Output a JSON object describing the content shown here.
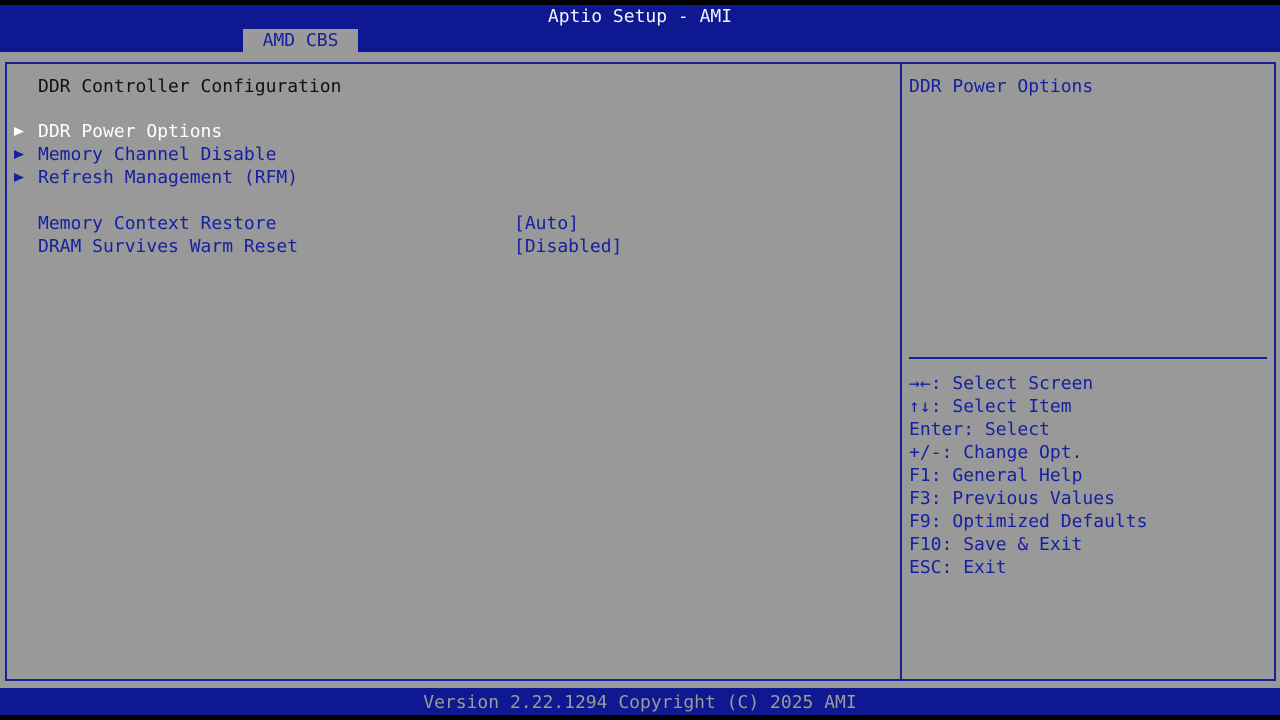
{
  "header": {
    "title": "Aptio Setup - AMI",
    "active_tab": "AMD CBS"
  },
  "page": {
    "heading": "DDR Controller Configuration",
    "submenus": [
      {
        "label": "DDR Power Options",
        "selected": true
      },
      {
        "label": "Memory Channel Disable",
        "selected": false
      },
      {
        "label": "Refresh Management (RFM)",
        "selected": false
      }
    ],
    "settings": [
      {
        "label": "Memory Context Restore",
        "value": "[Auto]"
      },
      {
        "label": "DRAM Survives Warm Reset",
        "value": "[Disabled]"
      }
    ]
  },
  "help_panel": {
    "description": "DDR Power Options",
    "keys": [
      {
        "key": "→←",
        "action": ": Select Screen"
      },
      {
        "key": "↑↓",
        "action": ": Select Item"
      },
      {
        "key": "Enter",
        "action": ": Select"
      },
      {
        "key": "+/-",
        "action": ": Change Opt."
      },
      {
        "key": "F1",
        "action": ": General Help"
      },
      {
        "key": "F3",
        "action": ": Previous Values"
      },
      {
        "key": "F9",
        "action": ": Optimized Defaults"
      },
      {
        "key": "F10",
        "action": ": Save & Exit"
      },
      {
        "key": "ESC",
        "action": ": Exit"
      }
    ]
  },
  "footer": {
    "version": "Version 2.22.1294 Copyright (C) 2025 AMI"
  },
  "colors": {
    "bar_blue": "#0e1891",
    "panel_gray": "#999999",
    "text_blue": "#1620a0",
    "highlight_white": "#ffffff"
  }
}
